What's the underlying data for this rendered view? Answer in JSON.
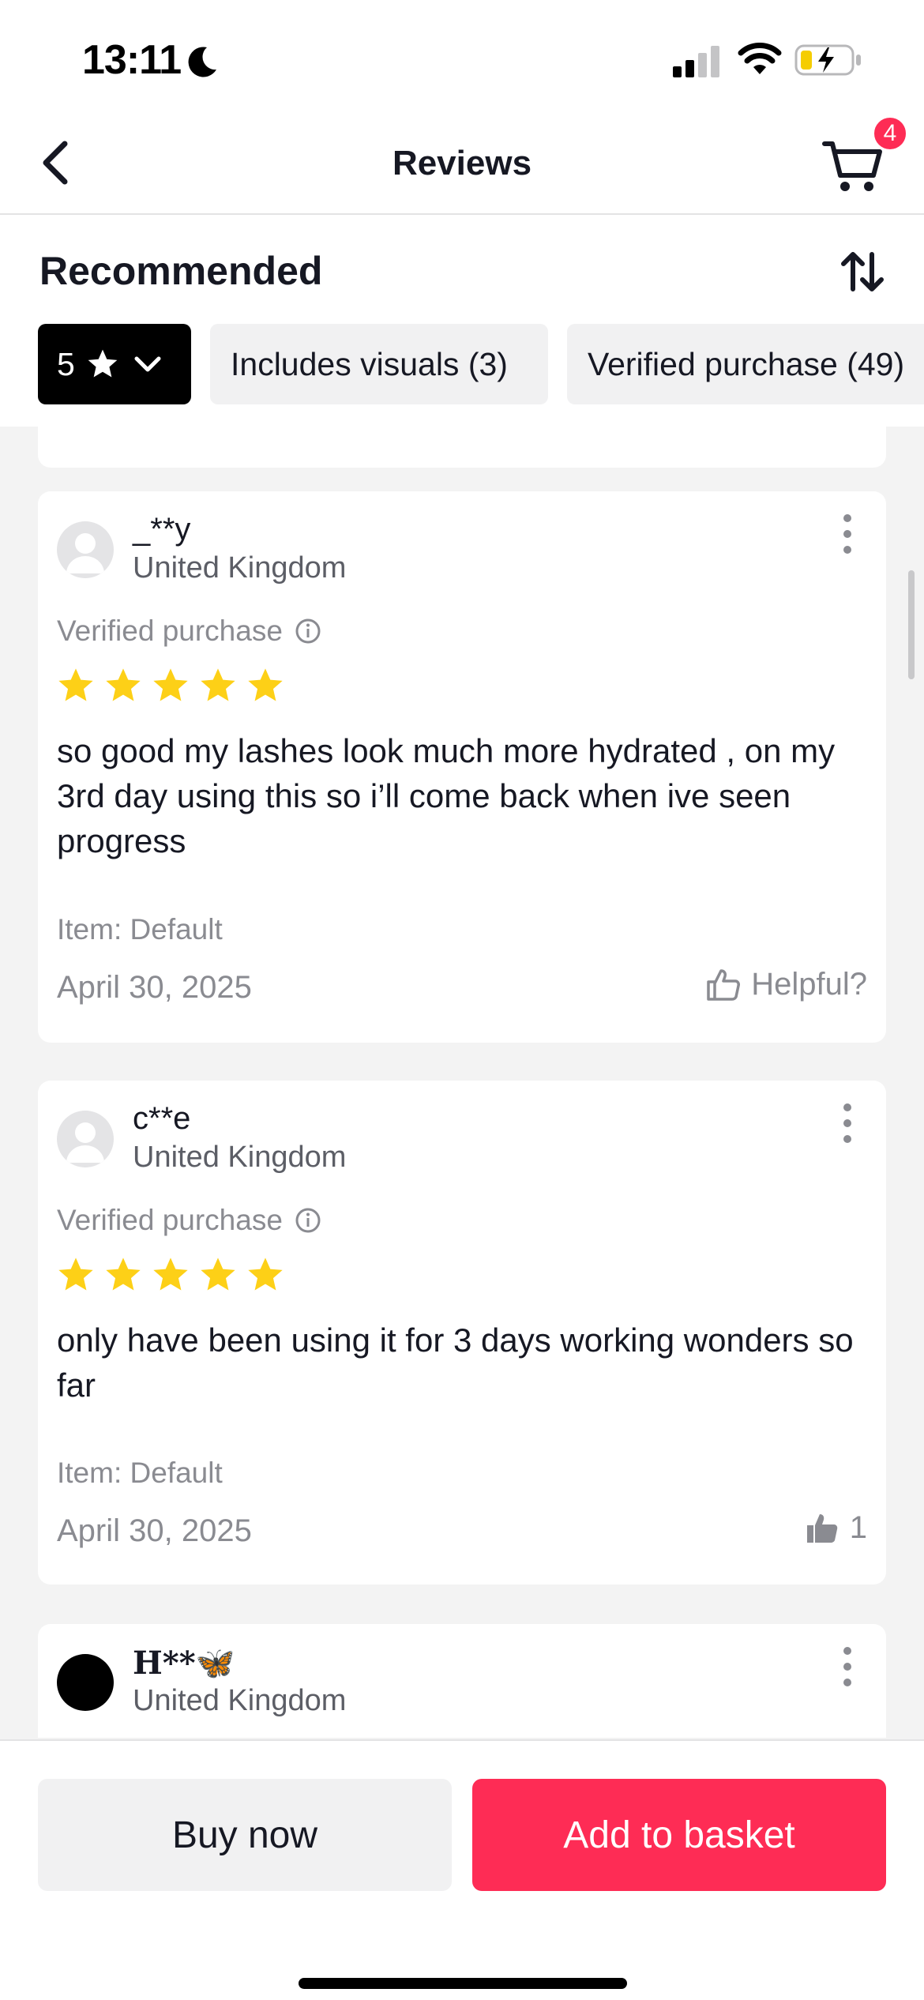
{
  "status_bar": {
    "time": "13:11"
  },
  "header": {
    "title": "Reviews",
    "cart_count": "4"
  },
  "sort": {
    "label": "Recommended"
  },
  "filters": {
    "rating_value": "5",
    "visuals": "Includes visuals (3)",
    "verified": "Verified purchase (49)"
  },
  "reviews": [
    {
      "username": "_**y",
      "country": "United Kingdom",
      "verified": "Verified purchase",
      "rating": 5,
      "text": "so good my lashes look much more hydrated , on my 3rd day using this so i’ll come back when ive seen progress",
      "item": "Item: Default",
      "date": "April 30, 2025",
      "helpful": "Helpful?"
    },
    {
      "username": "c**e",
      "country": "United Kingdom",
      "verified": "Verified purchase",
      "rating": 5,
      "text": "only have been using it for 3 days working wonders so far",
      "item": "Item: Default",
      "date": "April 30, 2025",
      "helpful": "1"
    },
    {
      "username": "H**🦋",
      "country": "United Kingdom"
    }
  ],
  "actions": {
    "buy": "Buy now",
    "basket": "Add to basket"
  },
  "colors": {
    "accent": "#fe2c55",
    "star": "#fdd017",
    "text": "#161823",
    "muted": "#8a8b91"
  }
}
